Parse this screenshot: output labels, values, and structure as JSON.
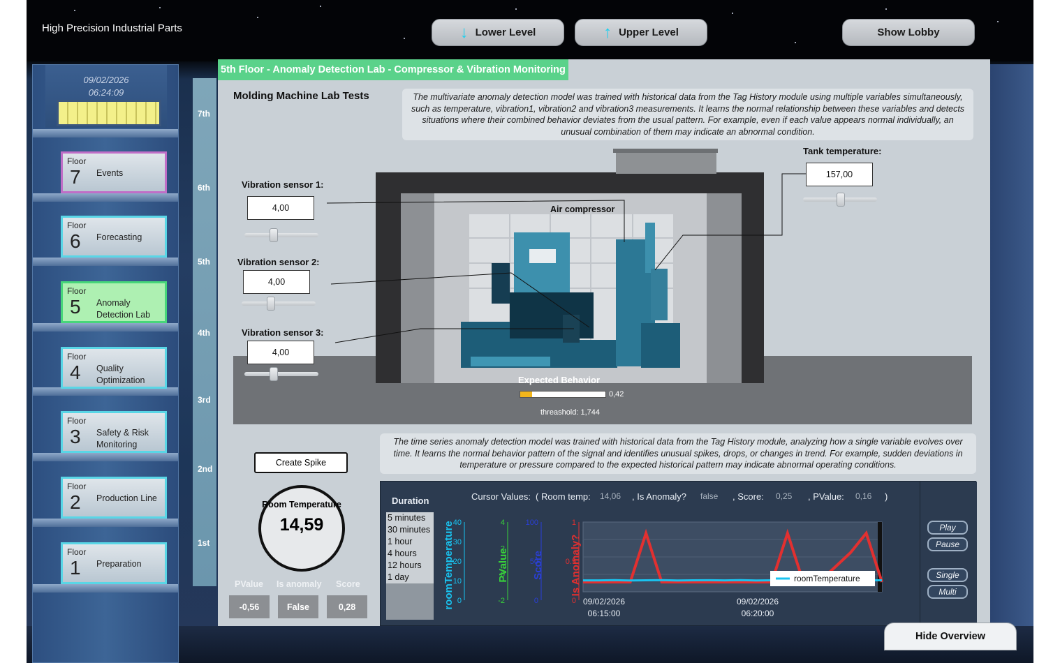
{
  "header": {
    "brand": "High Precision Industrial Parts",
    "lower_level": "Lower Level",
    "upper_level": "Upper Level",
    "show_lobby": "Show Lobby"
  },
  "tower": {
    "date": "09/02/2026",
    "time": "06:24:09",
    "floors": [
      {
        "floor_label": "Floor",
        "number": "7",
        "name": "Events"
      },
      {
        "floor_label": "Floor",
        "number": "6",
        "name": "Forecasting"
      },
      {
        "floor_label": "Floor",
        "number": "5",
        "name": "Anomaly Detection Lab"
      },
      {
        "floor_label": "Floor",
        "number": "4",
        "name": "Quality Optimization"
      },
      {
        "floor_label": "Floor",
        "number": "3",
        "name": "Safety & Risk Monitoring"
      },
      {
        "floor_label": "Floor",
        "number": "2",
        "name": "Production Line"
      },
      {
        "floor_label": "Floor",
        "number": "1",
        "name": "Preparation"
      }
    ],
    "levels": [
      "7th",
      "6th",
      "5th",
      "4th",
      "3rd",
      "2nd",
      "1st"
    ]
  },
  "panel": {
    "title": "5th Floor - Anomaly Detection Lab - Compressor & Vibration Monitoring",
    "lab_title": "Molding Machine Lab Tests",
    "info_multivariate": "The multivariate anomaly detection model was trained with historical data from the Tag History module using multiple variables simultaneously, such as temperature, vibration1, vibration2 and vibration3 measurements. It learns the normal relationship between these variables and detects situations where their combined behavior deviates from the usual pattern. For example, even if each value appears normal individually, an unusual combination of them may indicate an abnormal condition.",
    "info_timeseries": "The time series anomaly detection model was trained with historical data from the Tag History module, analyzing how a single variable evolves over time. It learns the normal behavior pattern of the signal and identifies unusual spikes, drops, or changes in trend. For example, sudden deviations in temperature or pressure compared to the expected historical pattern may indicate abnormal operating conditions.",
    "compressor_label": "Air compressor",
    "tank_label": "Tank temperature:",
    "tank_value": "157,00",
    "tank_slider": 0.5,
    "sensors": [
      {
        "label": "Vibration sensor 1:",
        "value": "4,00",
        "slider": 0.4
      },
      {
        "label": "Vibration sensor 2:",
        "value": "4,00",
        "slider": 0.4
      },
      {
        "label": "Vibration sensor 3:",
        "value": "4,00",
        "slider": 0.4
      }
    ],
    "expected_label": "Expected Behavior",
    "expected_value": "0,42",
    "expected_fraction": 0.14,
    "threshold_label": "threashold: 1,744",
    "create_spike": "Create Spike",
    "room_title": "Room Temperature",
    "room_value": "14,59",
    "pvalue_label": "PValue",
    "anomaly_label": "Is anomaly",
    "score_label": "Score",
    "pvalue": "-0,56",
    "anomaly": "False",
    "score": "0,28",
    "hide_overview": "Hide Overview"
  },
  "chart": {
    "duration_label": "Duration",
    "cursor_label": "Cursor Values:",
    "room_temp_label": "( Room temp:",
    "room_temp_value": "14,06",
    "is_anomaly_label": ", Is Anomaly?",
    "is_anomaly_value": "false",
    "score_label": ", Score:",
    "score_value": "0,25",
    "pvalue_label": ", PValue:",
    "pvalue_value": "0,16",
    "close_paren": ")",
    "durations": [
      "5 minutes",
      "30 minutes",
      "1 hour",
      "4 hours",
      "12 hours",
      "1 day"
    ],
    "play": "Play",
    "pause": "Pause",
    "single": "Single",
    "multi": "Multi",
    "legend": "roomTemperature",
    "colors": {
      "room": "#19c3f0",
      "pvalue": "#38d23a",
      "score": "#2a3fd8",
      "anomaly": "#e23030"
    },
    "chart_data": {
      "type": "line",
      "axes": [
        {
          "label": "roomTemperature",
          "ticks": [
            "0",
            "10",
            "20",
            "30",
            "40"
          ]
        },
        {
          "label": "PValue",
          "ticks": [
            "-2",
            "0",
            "2",
            "4"
          ]
        },
        {
          "label": "Score",
          "ticks": [
            "0",
            "50",
            "100"
          ]
        },
        {
          "label": "Is Anomaly?",
          "ticks": [
            "0",
            "0.5",
            "1"
          ]
        }
      ],
      "x_ticks": [
        {
          "date": "09/02/2026",
          "time": "06:15:00"
        },
        {
          "date": "09/02/2026",
          "time": "06:20:00"
        }
      ],
      "series": [
        {
          "name": "roomTemperature",
          "values": [
            14,
            14,
            14.5,
            13.8,
            14.2,
            14.6,
            13.9,
            14.1,
            14.3,
            14.0,
            14.5,
            13.7,
            14.2,
            14.4,
            14.0,
            14.1,
            14.2,
            13.9,
            14.3,
            14.1
          ]
        },
        {
          "name": "Is Anomaly?",
          "values": [
            0,
            0,
            0,
            0,
            1,
            0,
            0,
            0,
            0,
            0,
            0,
            0,
            0,
            1,
            0,
            0,
            0.3,
            0.6,
            1,
            0
          ]
        }
      ]
    }
  }
}
